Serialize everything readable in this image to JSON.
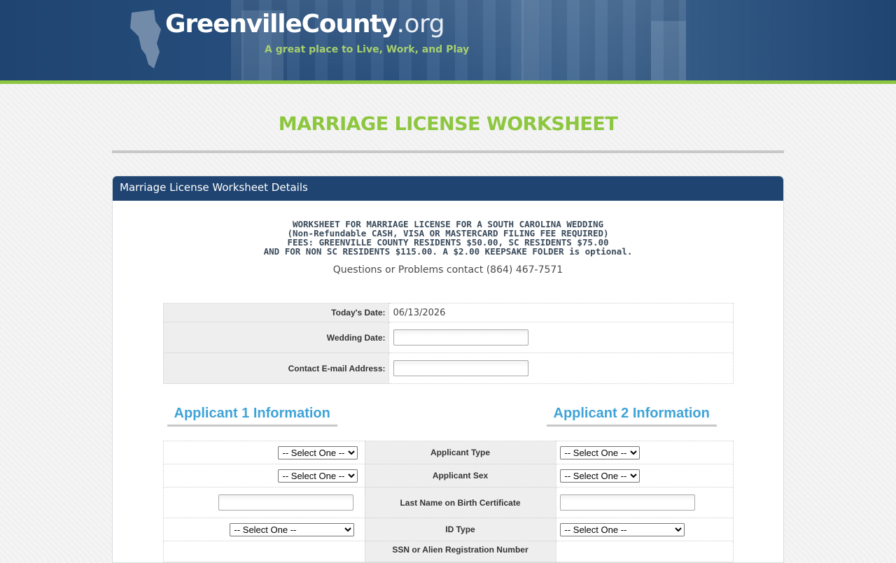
{
  "header": {
    "logo_main": "GreenvilleCounty",
    "logo_tld": ".org",
    "tagline": "A great place to Live, Work, and Play"
  },
  "page": {
    "title": "MARRIAGE LICENSE WORKSHEET",
    "panel_title": "Marriage License Worksheet Details"
  },
  "notice": {
    "line1": "WORKSHEET FOR MARRIAGE LICENSE FOR A SOUTH CAROLINA WEDDING",
    "line2": "(Non-Refundable CASH, VISA OR MASTERCARD FILING FEE REQUIRED)",
    "line3": "FEES: GREENVILLE COUNTY RESIDENTS $50.00, SC RESIDENTS $75.00",
    "line4": "AND FOR NON SC RESIDENTS $115.00. A $2.00 KEEPSAKE FOLDER is optional.",
    "contact": "Questions or Problems contact (864) 467-7571"
  },
  "form": {
    "todays_date_label": "Today's Date:",
    "todays_date_value": "06/13/2026",
    "wedding_date_label": "Wedding Date:",
    "wedding_date_value": "",
    "email_label": "Contact E-mail Address:",
    "email_value": ""
  },
  "applicants": {
    "heading_1": "Applicant 1 Information",
    "heading_2": "Applicant 2 Information",
    "select_placeholder": "-- Select One --",
    "rows": {
      "applicant_type": "Applicant Type",
      "applicant_sex": "Applicant Sex",
      "last_name": "Last Name on Birth Certificate",
      "id_type": "ID Type",
      "ssn": "SSN or Alien Registration Number"
    }
  },
  "colors": {
    "header_blue": "#1f4471",
    "accent_green": "#8dc63f",
    "heading_blue": "#3fa3d8"
  }
}
